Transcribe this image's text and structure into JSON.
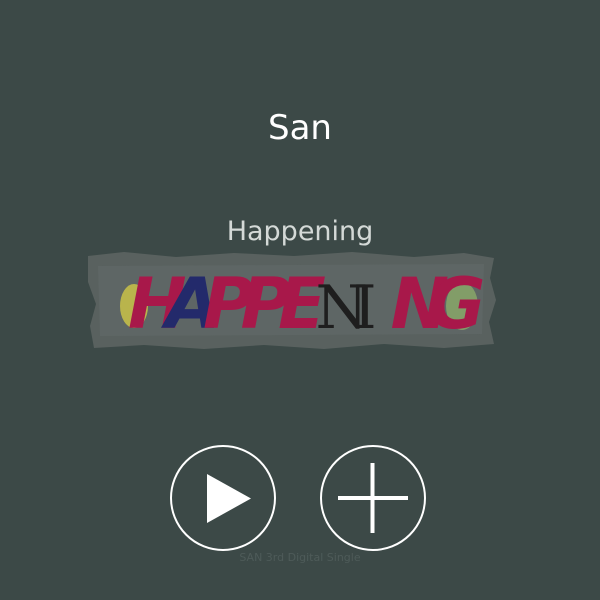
{
  "artist": {
    "name": "San"
  },
  "track": {
    "title": "Happening"
  },
  "cover_art": {
    "text": "HAPPENING",
    "letter_colors": [
      "#a8184a",
      "#232a6b",
      "#a8184a",
      "#a8184a",
      "#a8184a",
      "#1e1e1e",
      "#1e1e1e",
      "#a8184a",
      "#a8184a"
    ],
    "accent_yellow": "#c9c248",
    "accent_green": "#8fb06a",
    "tape_color": "#5a6260"
  },
  "album": {
    "caption": "SAN 3rd Digital Single"
  },
  "controls": {
    "play_icon": "play-icon",
    "add_icon": "plus-icon"
  },
  "colors": {
    "background": "#3c4947",
    "foreground": "#ffffff"
  }
}
